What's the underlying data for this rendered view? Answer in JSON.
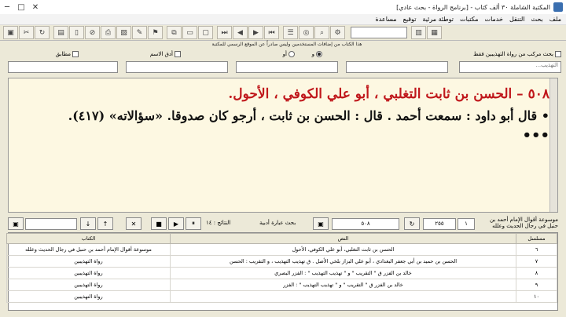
{
  "window": {
    "title": "المكتبة الشاملة ٣٠ ألف كتاب - [برنامج الرواة - بحث عادي]",
    "controls": [
      "─",
      "□",
      "✕"
    ]
  },
  "menu": [
    "ملف",
    "بحث",
    "التنقل",
    "خدمات",
    "مكتبات",
    "توطئة مرئية",
    "توقيع",
    "مساعدة"
  ],
  "toolbar_icons": [
    "save-icon",
    "tools-icon",
    "refresh-icon",
    "book-icon",
    "page-icon",
    "open-icon",
    "print-icon",
    "image-icon",
    "edit-icon",
    "bookmark-icon",
    "copy-icon",
    "paste-icon",
    "doc-icon",
    "next-icon",
    "last-icon",
    "prev-icon",
    "first-icon",
    "list-icon",
    "binoculars-icon",
    "search-icon",
    "settings-icon",
    "book-open-icon",
    "library-icon"
  ],
  "notice": "هذا الكتاب من إضافات المستخدمين وليس صادراً عن الموقع الرسمي للمكتبة",
  "options": {
    "search_in_tahdheeb": "بحث مركب من رواة التهذيبين فقط",
    "and": "و",
    "or": "أو",
    "sibling_name": "أدق الاسم",
    "exact": "مطابق",
    "tahdheeb_field_placeholder": "التهذيب..."
  },
  "entry": {
    "title": "٥٠٨ – الحسن بن ثابت التغلبي ، أبو علي الكوفي ، الأحول.",
    "body": "• قال أبو داود : سمعت أحمد . قال : الحسن بن ثابت ، أرجو كان صدوقا. «سؤالاته» (٤١٧).",
    "more": "•••"
  },
  "nav": {
    "page_from": "١",
    "page_to": "٢٥٥",
    "current": "٥٠٨",
    "source_label": "موسوعة أقوال الإمام أحمد بن حنبل في رجال الحديث وعلله",
    "search_result_label": "بحث عبارة أدبية",
    "results_count": "النتائج : ١٤",
    "buttons": [
      "■",
      "▶",
      "⏸",
      "✕",
      "↑",
      "↓"
    ]
  },
  "grid": {
    "columns": [
      "مسلسل",
      "النص",
      "الكتاب"
    ],
    "rows": [
      {
        "num": "٦",
        "text": "الحسن بن ثابت التغلبي، أبو علي الكوفي، الأحول",
        "book": "موسوعة أقوال الإمام أحمد بن حنبل في رجال الحديث وعلله"
      },
      {
        "num": "٧",
        "text": "الحسن بن حميد بن أبي جعفر البغدادي ، أبو علي البزاز بلخي الأصل . ق تهذيب التهذيب ، و التقريب : الحسن",
        "book": "رواة التهذيبين"
      },
      {
        "num": "٨",
        "text": "خالد بن الفزر ق \" التقريب \" و \" تهذيب التهذيب \" : الفزر البصري",
        "book": "رواة التهذيبين"
      },
      {
        "num": "٩",
        "text": "خالد بن الفزر ق \" التقريب \" و \" تهذيب التهذيب \" : الفزر",
        "book": "رواة التهذيبين"
      },
      {
        "num": "١٠",
        "text": "",
        "book": "رواة التهذيبين"
      }
    ]
  }
}
